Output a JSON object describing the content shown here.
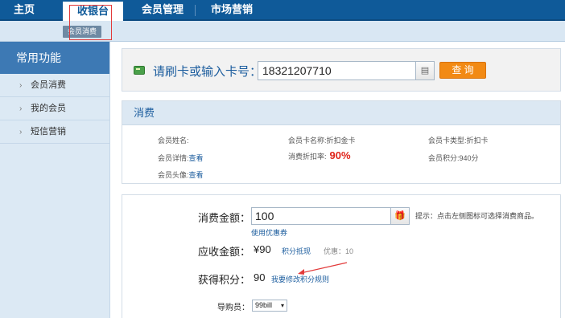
{
  "topnav": {
    "tabs": [
      {
        "label": "主页",
        "active": false
      },
      {
        "label": "收银台",
        "active": true
      },
      {
        "label": "会员管理",
        "active": false
      },
      {
        "label": "市场营销",
        "active": false
      }
    ]
  },
  "subnav": {
    "active_label": "会员消费"
  },
  "sidebar": {
    "title": "常用功能",
    "items": [
      {
        "label": "会员消费"
      },
      {
        "label": "我的会员"
      },
      {
        "label": "短信营销"
      }
    ]
  },
  "card": {
    "label": "请刷卡或输入卡号：",
    "value": "18321207710",
    "query_label": "查 询"
  },
  "info": {
    "title": "消费",
    "name_label": "会员姓名:",
    "card_name_label": "会员卡名称:",
    "card_name_value": "折扣金卡",
    "card_type_label": "会员卡类型:",
    "card_type_value": "折扣卡",
    "detail_label": "会员详情:",
    "detail_link": "查看",
    "discount_label": "消费折扣率:",
    "discount_value": "90%",
    "points_label": "会员积分:",
    "points_value": "940分",
    "avatar_label": "会员头像:",
    "avatar_link": "查看"
  },
  "consume": {
    "amount_label": "消费金额：",
    "amount_value": "100",
    "tip": "提示：点击左侧图标可选择消费商品。",
    "coupon_link": "使用优惠券",
    "receivable_label": "应收金额：",
    "receivable_value": "¥90",
    "points_deduct_link": "积分抵现",
    "discount_note": "优惠：10",
    "earn_label": "获得积分：",
    "earn_value": "90",
    "rule_link": "我要修改积分规则",
    "guide_label": "导购员：",
    "guide_value": "99bill"
  },
  "colors": {
    "nav_bg": "#0f5a99",
    "accent_orange": "#f28a14",
    "discount_red": "#e0241a",
    "link_blue": "#1c5d9e",
    "highlight_red": "#e23a3a"
  }
}
